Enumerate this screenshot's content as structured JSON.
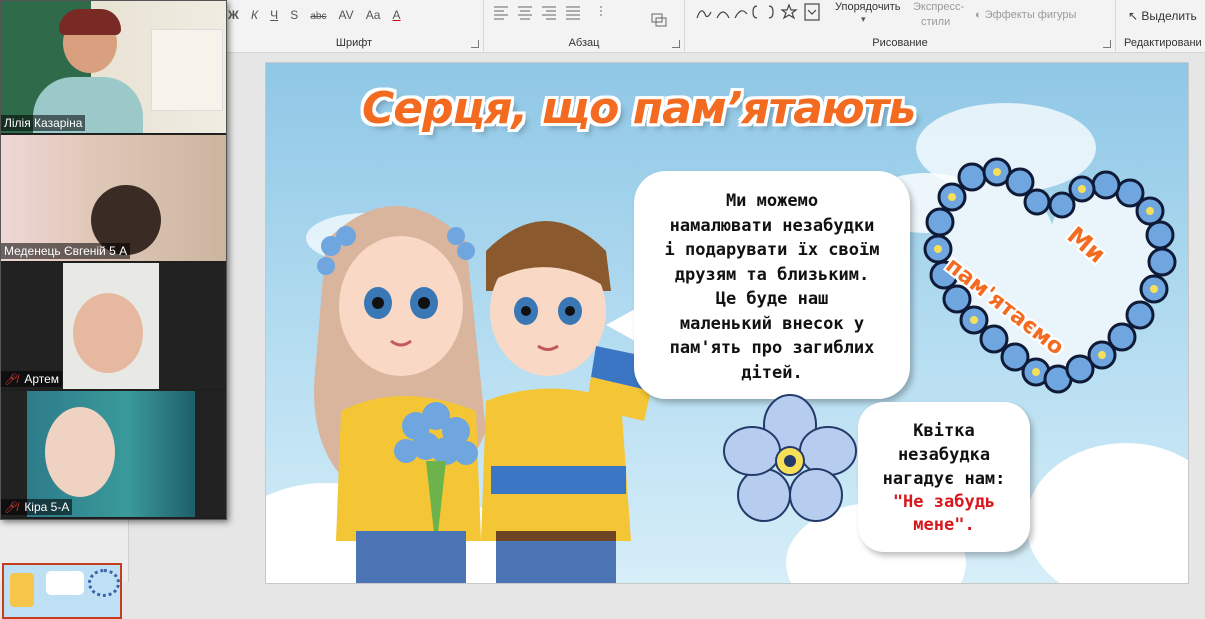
{
  "ribbon": {
    "font_group": {
      "label": "Шрифт",
      "buttons": [
        "Ж",
        "К",
        "Ч",
        "S",
        "abc",
        "AV",
        "Aa",
        "A"
      ]
    },
    "paragraph_group": {
      "label": "Абзац"
    },
    "drawing_group": {
      "label": "Рисование",
      "arrange": "Упорядочить",
      "quick_styles_line1": "Экспресс-",
      "quick_styles_line2": "стили",
      "shape_effects": "Эффекты фигуры"
    },
    "editing_group": {
      "label": "Редактировани",
      "select": "Выделить"
    }
  },
  "video_participants": [
    {
      "name": "Лілія Казаріна",
      "muted": false
    },
    {
      "name": "Меденець Євгеній 5 А",
      "muted": false
    },
    {
      "name": "Артем",
      "muted": true
    },
    {
      "name": "Кіра 5-А",
      "muted": true
    }
  ],
  "slide": {
    "title": "Серця, що пам’ятають",
    "bubble1_text": "Ми можемо\nнамалювати незабудки\nі подарувати їх своїм\nдрузям та близьким.\nЦе буде наш\nмаленький внесок у\nпам'ять про загиблих\nдітей.",
    "bubble2_text": "Квітка\nнезабудка\nнагадує нам:",
    "bubble2_quote": "\"Не забудь\nмене\".",
    "wreath_text_1": "Ми",
    "wreath_text_2": "пам'ятаємо"
  },
  "colors": {
    "title_orange": "#f36b21",
    "quote_red": "#d8171c",
    "slide_sky": "#8fc7e6",
    "ribbon_bg": "#f3f3f3"
  }
}
